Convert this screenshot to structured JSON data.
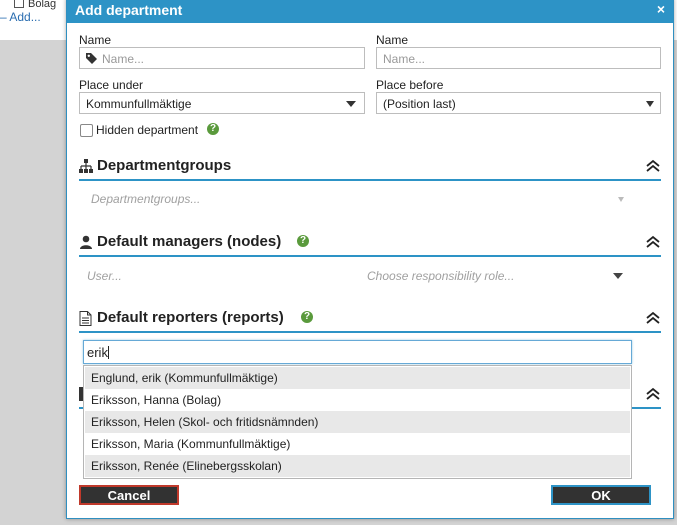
{
  "background": {
    "item_label": "Bolag",
    "add_link": "– Add..."
  },
  "dialog": {
    "title": "Add department",
    "close_icon": "×",
    "name_left": {
      "label": "Name",
      "placeholder": "Name...",
      "icon": "tag-icon"
    },
    "name_right": {
      "label": "Name",
      "placeholder": "Name..."
    },
    "place_under": {
      "label": "Place under",
      "value": "Kommunfullmäktige"
    },
    "place_before": {
      "label": "Place before",
      "value": "(Position last)"
    },
    "hidden_department": {
      "label": "Hidden department",
      "checked": false
    },
    "sections": {
      "departmentgroups": {
        "title": "Departmentgroups",
        "icon": "sitemap-icon",
        "placeholder": "Departmentgroups..."
      },
      "default_managers": {
        "title": "Default managers (nodes)",
        "icon": "user-icon",
        "user_placeholder": "User...",
        "role_placeholder": "Choose responsibility role..."
      },
      "default_reporters": {
        "title": "Default reporters (reports)",
        "icon": "document-icon",
        "search_value": "erik",
        "options": [
          "Englund, erik (Kommunfullmäktige)",
          "Eriksson, Hanna (Bolag)",
          "Eriksson, Helen (Skol- och fritidsnämnden)",
          "Eriksson, Maria (Kommunfullmäktige)",
          "Eriksson, Renée (Elinebergsskolan)"
        ]
      }
    },
    "buttons": {
      "cancel": "Cancel",
      "ok": "OK"
    },
    "colors": {
      "accent": "#2d93c6",
      "cancel_border": "#c0392b",
      "help": "#5a9a3c"
    }
  }
}
